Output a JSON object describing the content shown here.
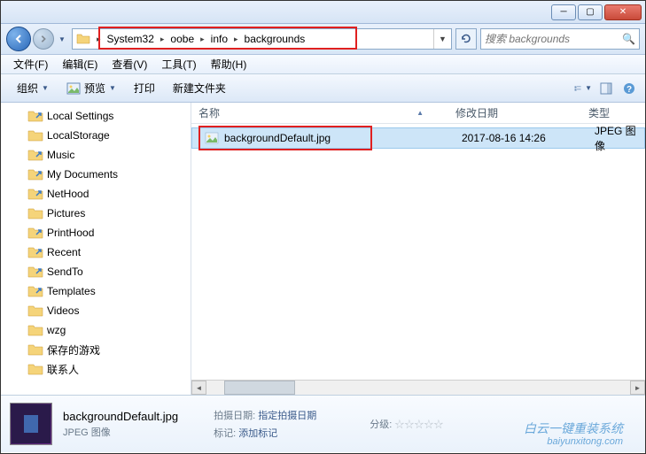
{
  "window": {
    "min": "─",
    "max": "▢",
    "close": "✕"
  },
  "breadcrumbs": [
    "System32",
    "oobe",
    "info",
    "backgrounds"
  ],
  "search": {
    "placeholder": "搜索 backgrounds"
  },
  "menubar": [
    "文件(F)",
    "编辑(E)",
    "查看(V)",
    "工具(T)",
    "帮助(H)"
  ],
  "toolbar": {
    "organize": "组织",
    "preview": "预览",
    "print": "打印",
    "newfolder": "新建文件夹"
  },
  "tree": [
    {
      "label": "Local Settings",
      "ico": "folder-link"
    },
    {
      "label": "LocalStorage",
      "ico": "folder"
    },
    {
      "label": "Music",
      "ico": "folder-link"
    },
    {
      "label": "My Documents",
      "ico": "folder-link"
    },
    {
      "label": "NetHood",
      "ico": "folder-link"
    },
    {
      "label": "Pictures",
      "ico": "folder"
    },
    {
      "label": "PrintHood",
      "ico": "folder-link"
    },
    {
      "label": "Recent",
      "ico": "folder-link"
    },
    {
      "label": "SendTo",
      "ico": "folder-link"
    },
    {
      "label": "Templates",
      "ico": "folder-link"
    },
    {
      "label": "Videos",
      "ico": "folder"
    },
    {
      "label": "wzg",
      "ico": "folder"
    },
    {
      "label": "保存的游戏",
      "ico": "folder"
    },
    {
      "label": "联系人",
      "ico": "folder"
    }
  ],
  "columns": {
    "name": "名称",
    "date": "修改日期",
    "type": "类型"
  },
  "files": [
    {
      "name": "backgroundDefault.jpg",
      "date": "2017-08-16 14:26",
      "type": "JPEG 图像"
    }
  ],
  "details": {
    "name": "backgroundDefault.jpg",
    "type": "JPEG 图像",
    "shot_label": "拍摄日期:",
    "shot_val": "指定拍摄日期",
    "tag_label": "标记:",
    "tag_val": "添加标记",
    "rating_label": "分级:"
  },
  "watermark": {
    "line1": "白云一键重装系统",
    "line2": "baiyunxitong.com"
  }
}
